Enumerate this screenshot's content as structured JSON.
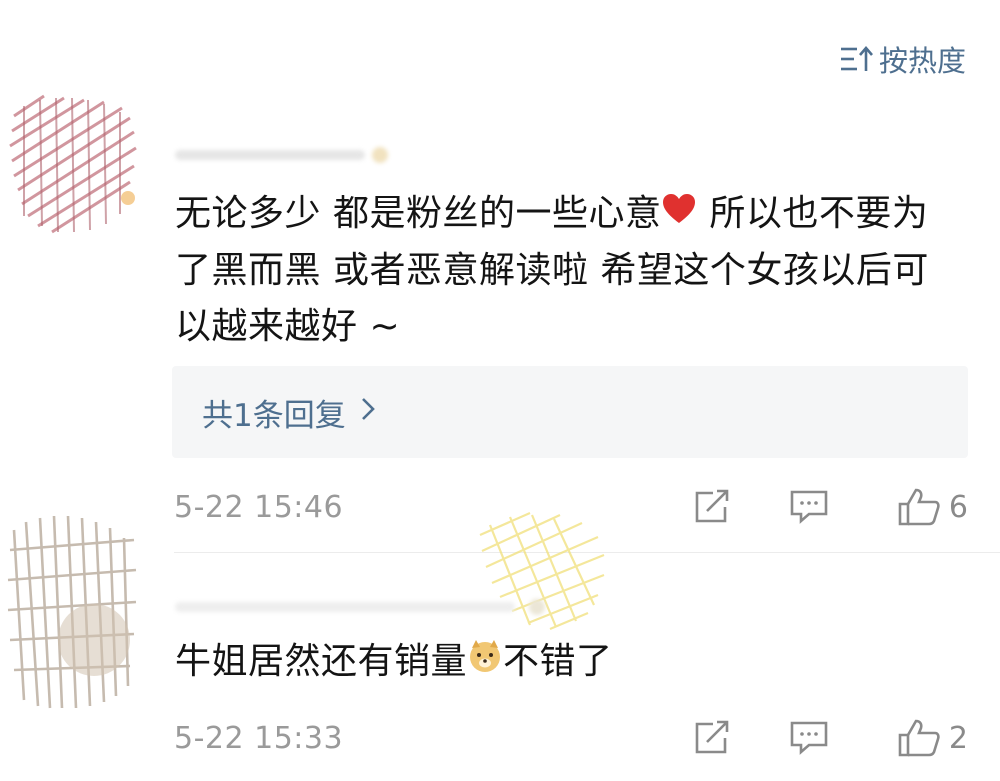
{
  "sort": {
    "label": "按热度"
  },
  "comments": [
    {
      "text_before_emoji": "无论多少 都是粉丝的一些心意",
      "emoji": "heart-emoji",
      "text_after_emoji": " 所以也不要为了黑而黑 或者恶意解读啦 希望这个女孩以后可以越来越好 ~",
      "replies_label": "共1条回复",
      "timestamp": "5-22 15:46",
      "likes": "6"
    },
    {
      "text_before_emoji": "牛姐居然还有销量",
      "emoji": "doge-emoji",
      "text_after_emoji": "不错了",
      "timestamp": "5-22 15:33",
      "likes": "2"
    }
  ],
  "colors": {
    "link": "#4e6f8f",
    "meta": "#9a9a9a",
    "reply_bg": "#f5f6f7"
  }
}
